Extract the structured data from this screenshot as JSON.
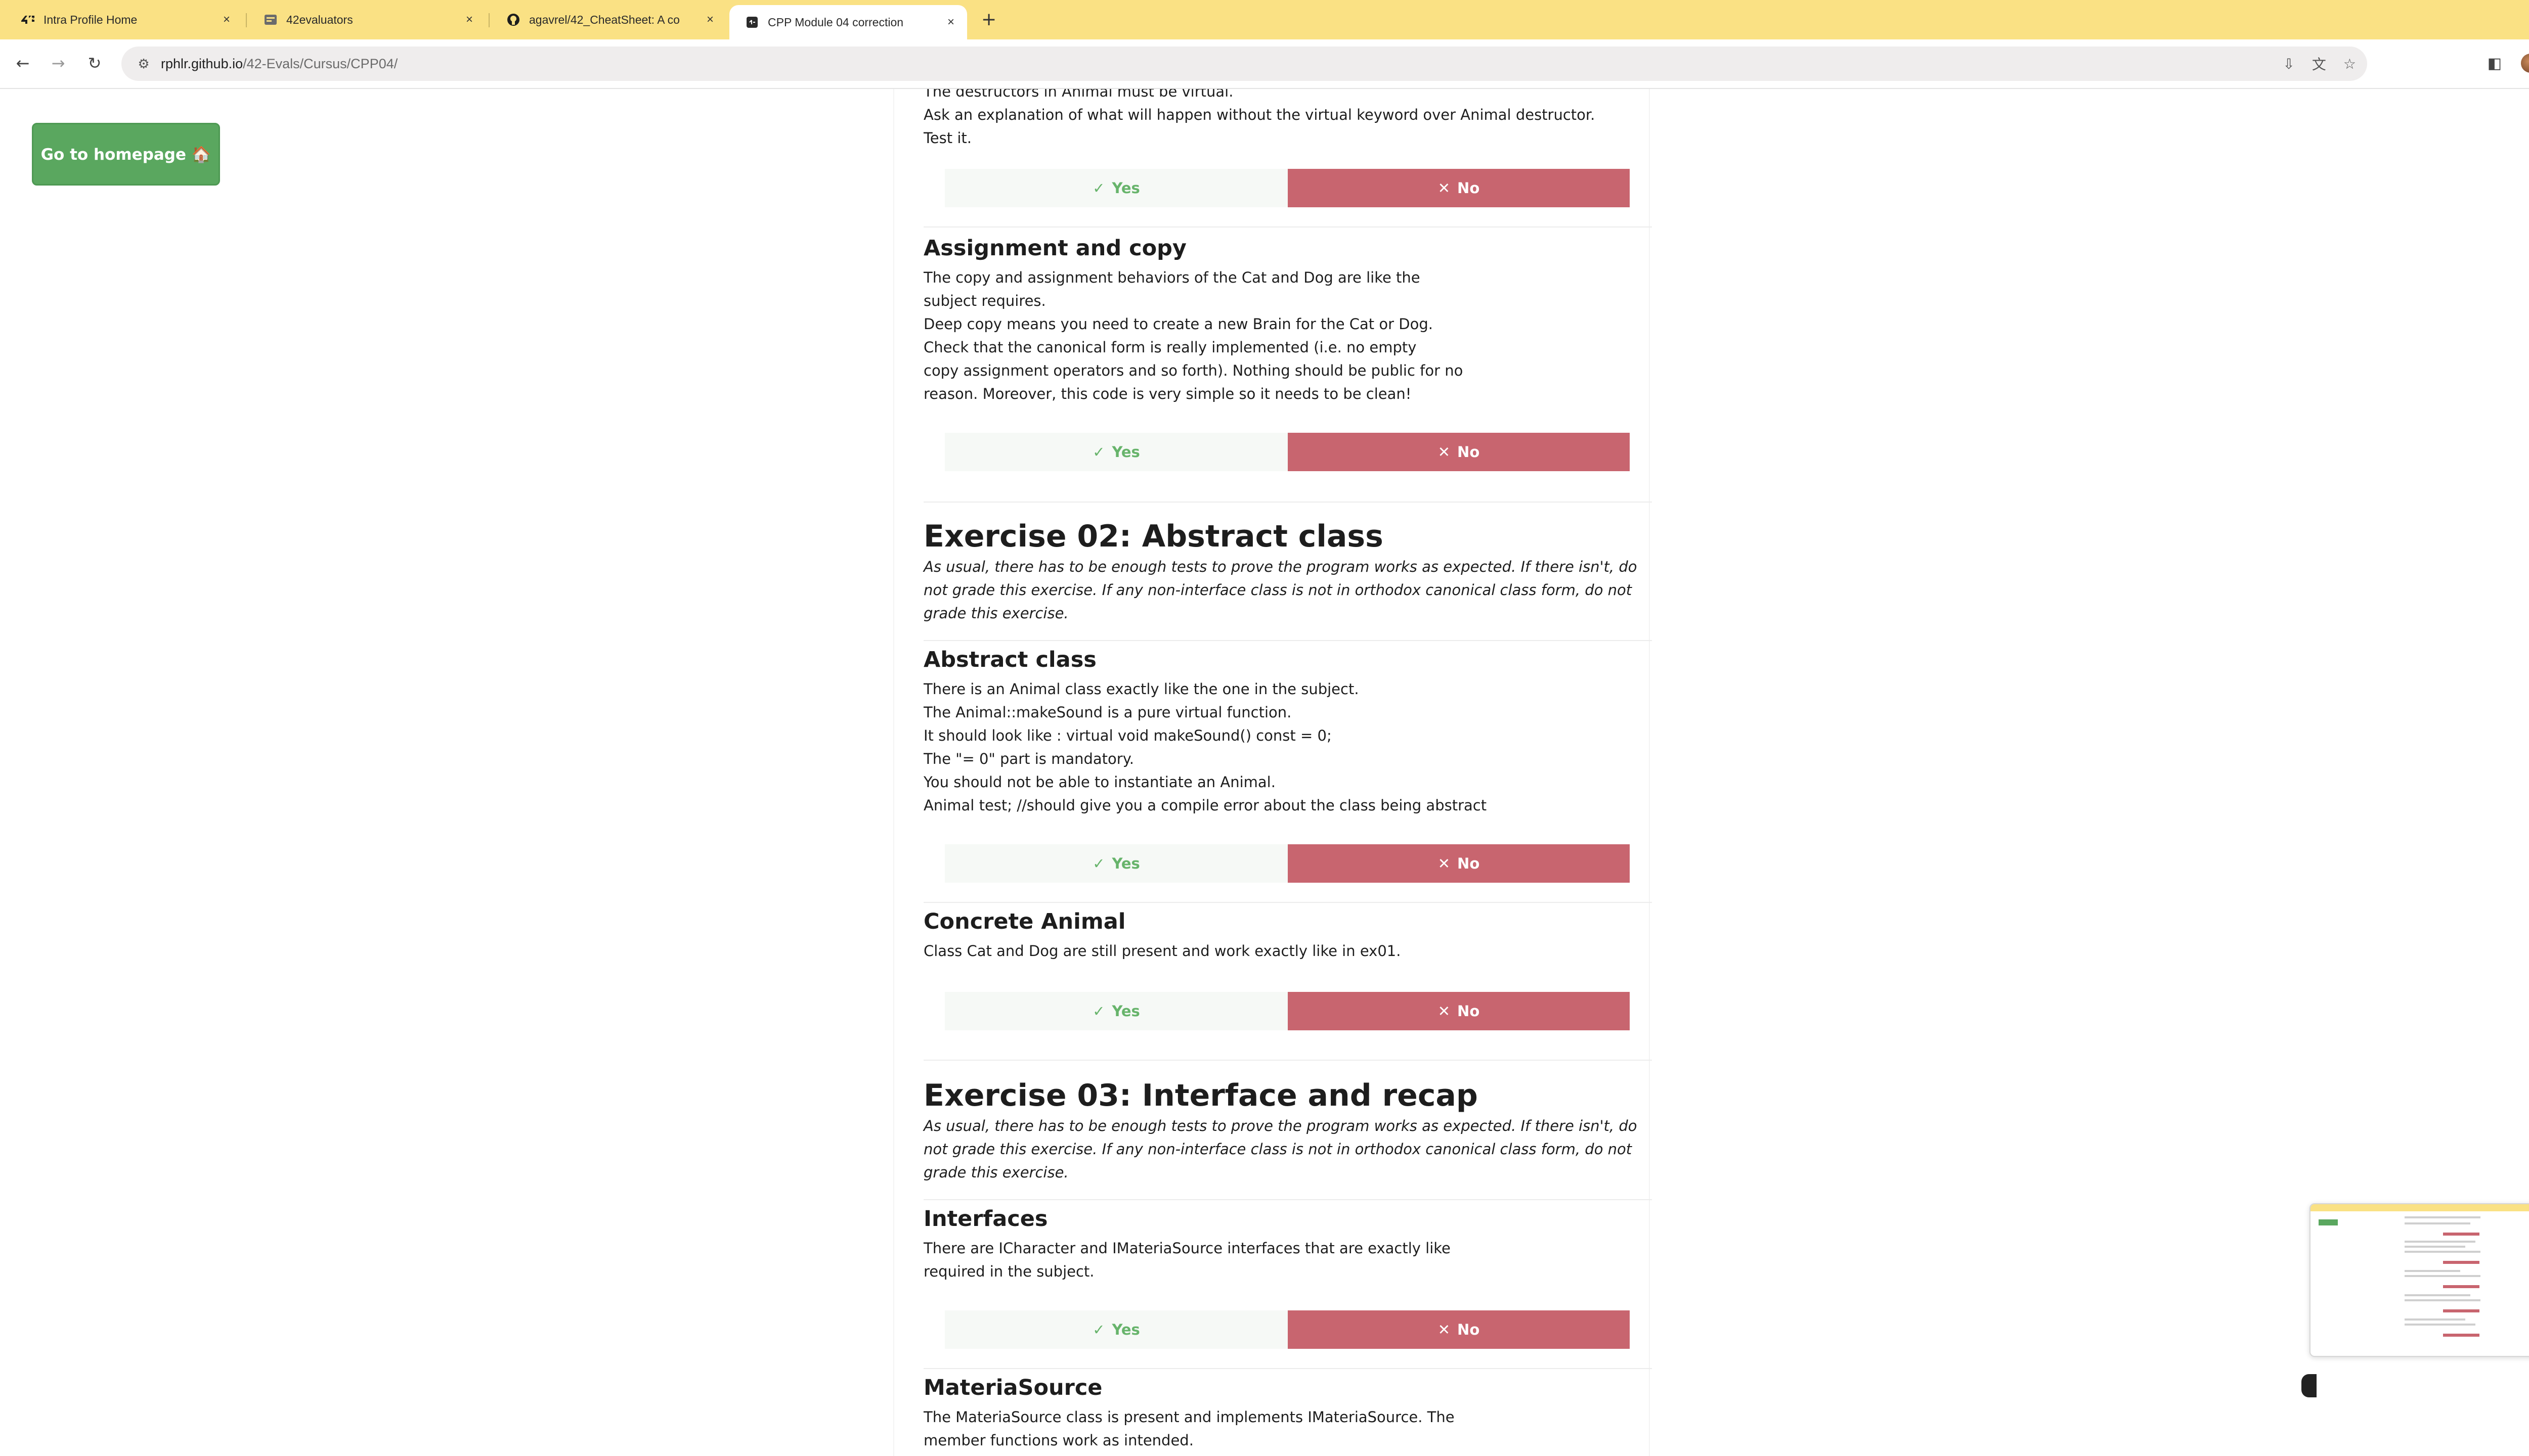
{
  "browser": {
    "tabs": [
      {
        "title": "Intra Profile Home",
        "icon": "42-logo-icon",
        "close": "×"
      },
      {
        "title": "42evaluators",
        "icon": "42evaluators-icon",
        "close": "×"
      },
      {
        "title": "agavrel/42_CheatSheet: A co",
        "icon": "github-icon",
        "close": "×"
      },
      {
        "title": "CPP Module 04 correction",
        "icon": "page-icon",
        "close": "×"
      }
    ],
    "new_tab": "+",
    "address": {
      "host": "rphlr.github.io",
      "path": "/42-Evals/Cursus/CPP04/"
    }
  },
  "page": {
    "home_button": "Go to homepage 🏠",
    "yes_label": "Yes",
    "no_label": "No",
    "yes_icon": "✓",
    "no_icon": "✕",
    "top_fragment": [
      "The destructors in Animal must be virtual.",
      "Ask an explanation of what will happen without the virtual keyword over Animal destructor.",
      "Test it."
    ],
    "sections": [
      {
        "title": "Assignment and copy",
        "lines": [
          "The copy and assignment behaviors of the Cat and Dog are like the",
          "subject requires.",
          "Deep copy means you need to create a new Brain for the Cat or Dog.",
          "Check that the canonical form is really implemented (i.e. no empty",
          "copy assignment operators and so forth). Nothing should be public for no",
          "reason. Moreover, this code is very simple so it needs to be clean!"
        ]
      }
    ],
    "exercise02": {
      "title": "Exercise 02: Abstract class",
      "desc": [
        "As usual, there has to be enough tests to prove the program works as expected. If there isn't, do",
        "not grade this exercise. If any non-interface class is not in orthodox canonical class form, do not",
        "grade this exercise."
      ],
      "abstract": {
        "title": "Abstract class",
        "lines": [
          "There is an Animal class exactly like the one in the subject.",
          "The Animal::makeSound is a pure virtual function.",
          "It should look like : virtual void makeSound() const = 0;",
          "The \"= 0\" part is mandatory.",
          "You should not be able to instantiate an Animal.",
          "Animal test; //should give you a compile error about the class being abstract"
        ]
      },
      "concrete": {
        "title": "Concrete Animal",
        "lines": [
          "Class Cat and Dog are still present and work exactly like in ex01."
        ]
      }
    },
    "exercise03": {
      "title": "Exercise 03: Interface and recap",
      "desc": [
        "As usual, there has to be enough tests to prove the program works as expected. If there isn't, do",
        "not grade this exercise. If any non-interface class is not in orthodox canonical class form, do not",
        "grade this exercise."
      ],
      "interfaces": {
        "title": "Interfaces",
        "lines": [
          "There are ICharacter and IMateriaSource interfaces that are exactly like",
          "required in the subject."
        ]
      },
      "materia": {
        "title": "MateriaSource",
        "lines": [
          "The MateriaSource class is present and implements IMateriaSource. The",
          "member functions work as intended."
        ]
      }
    }
  },
  "colors": {
    "tabbar": "#fae184",
    "home_button": "#5aa75f",
    "no_button": "#c8656f",
    "yes_text": "#67b46b"
  }
}
